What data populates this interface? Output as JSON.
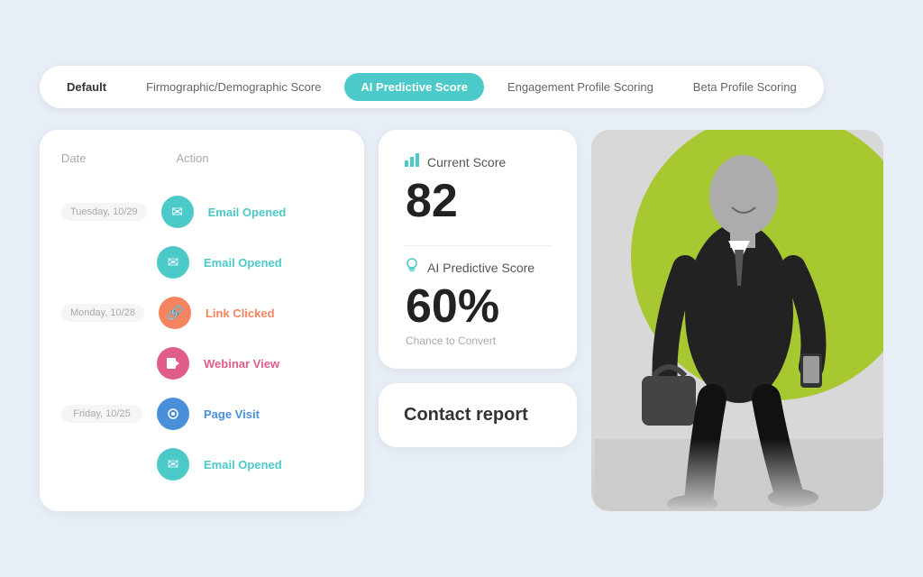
{
  "tabs": [
    {
      "id": "default",
      "label": "Default",
      "active": false,
      "bold": true
    },
    {
      "id": "firmographic",
      "label": "Firmographic/Demographic Score",
      "active": false
    },
    {
      "id": "ai-predictive",
      "label": "AI Predictive Score",
      "active": true
    },
    {
      "id": "engagement",
      "label": "Engagement Profile Scoring",
      "active": false
    },
    {
      "id": "beta",
      "label": "Beta Profile Scoring",
      "active": false
    }
  ],
  "activity": {
    "col_date": "Date",
    "col_action": "Action",
    "rows": [
      {
        "date": "Tuesday, 10/29",
        "icon": "✉",
        "icon_class": "icon-teal",
        "label": "Email Opened",
        "label_class": ""
      },
      {
        "date": "",
        "icon": "✉",
        "icon_class": "icon-teal",
        "label": "Email Opened",
        "label_class": ""
      },
      {
        "date": "Monday, 10/28",
        "icon": "🔗",
        "icon_class": "icon-salmon",
        "label": "Link Clicked",
        "label_class": "salmon"
      },
      {
        "date": "",
        "icon": "▶",
        "icon_class": "icon-pink",
        "label": "Webinar View",
        "label_class": "pink"
      },
      {
        "date": "Friday, 10/25",
        "icon": "◉",
        "icon_class": "icon-blue",
        "label": "Page Visit",
        "label_class": "blue"
      },
      {
        "date": "",
        "icon": "✉",
        "icon_class": "icon-teal",
        "label": "Email Opened",
        "label_class": ""
      }
    ]
  },
  "score_card": {
    "current_score_label": "Current Score",
    "current_score_value": "82",
    "ai_score_label": "AI Predictive Score",
    "ai_score_value": "60%",
    "chance_label": "Chance to Convert"
  },
  "contact_report": {
    "title": "Contact report"
  },
  "icons": {
    "bar_chart": "📊",
    "bulb": "💡"
  }
}
